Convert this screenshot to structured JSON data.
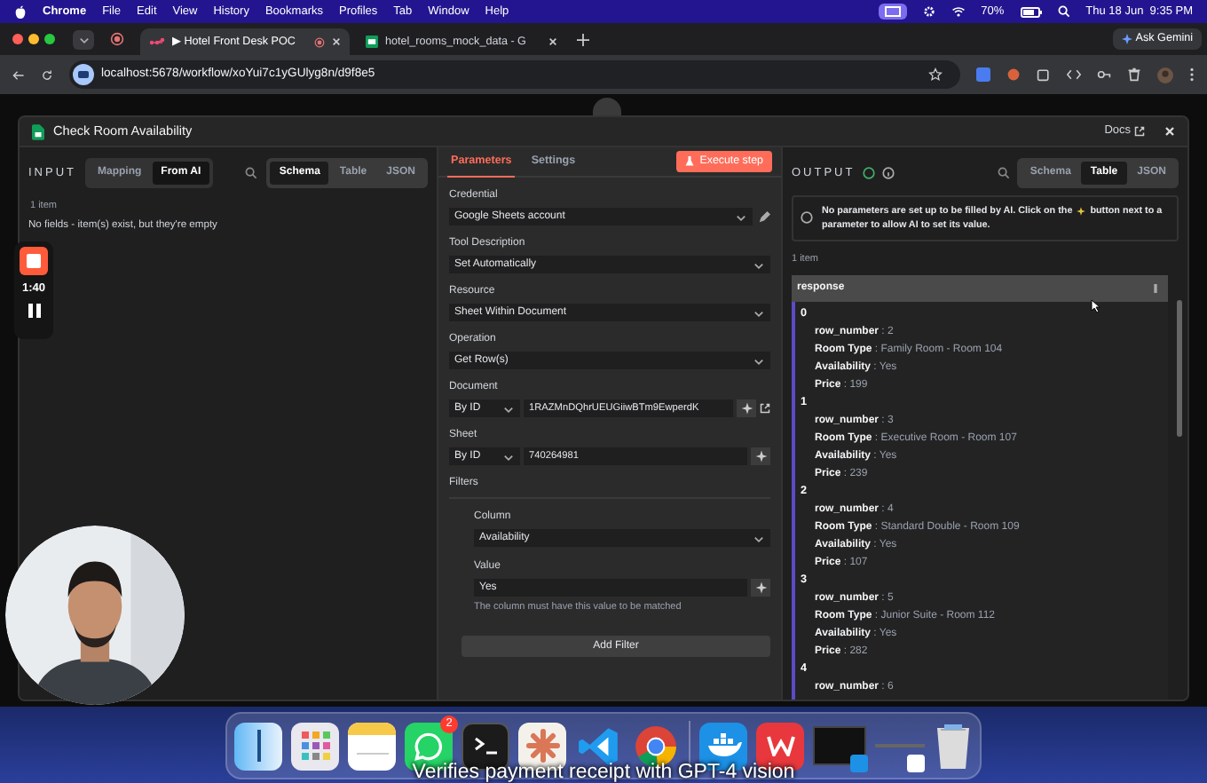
{
  "menu_bar": {
    "app": "Chrome",
    "items": [
      "File",
      "Edit",
      "View",
      "History",
      "Bookmarks",
      "Profiles",
      "Tab",
      "Window",
      "Help"
    ],
    "battery": "70%",
    "clock": "Thu 18 Jun  9:35 PM"
  },
  "browser": {
    "tabs": [
      {
        "title": "▶ Hotel Front Desk POC",
        "selected": true,
        "kind": "n8n"
      },
      {
        "title": "hotel_rooms_mock_data - G",
        "selected": false,
        "kind": "sheets"
      }
    ],
    "gemini": "Ask Gemini",
    "url": "localhost:5678/workflow/xoYui7c1yGUlyg8n/d9f8e5"
  },
  "modal": {
    "title": "Check Room Availability",
    "docs": "Docs",
    "input": {
      "label": "INPUT",
      "modes": [
        {
          "label": "Mapping",
          "selected": false
        },
        {
          "label": "From AI",
          "selected": true
        }
      ],
      "views": [
        {
          "label": "Schema",
          "selected": true
        },
        {
          "label": "Table",
          "selected": false
        },
        {
          "label": "JSON",
          "selected": false
        }
      ],
      "count": "1 item",
      "message": "No fields - item(s) exist, but they're empty"
    },
    "parameters": {
      "tabs": [
        {
          "label": "Parameters",
          "selected": true
        },
        {
          "label": "Settings",
          "selected": false
        }
      ],
      "execute": "Execute step",
      "fields": [
        {
          "kind": "select",
          "label": "Credential",
          "value": "Google Sheets account",
          "editable": true
        },
        {
          "kind": "select",
          "label": "Tool Description",
          "value": "Set Automatically",
          "editable": false
        },
        {
          "kind": "select",
          "label": "Resource",
          "value": "Sheet Within Document",
          "editable": false
        },
        {
          "kind": "select",
          "label": "Operation",
          "value": "Get Row(s)",
          "editable": false
        },
        {
          "kind": "by_id",
          "label": "Document",
          "mode": "By ID",
          "value": "1RAZMnDQhrUEUGiiwBTm9EwperdK",
          "open_link": true
        },
        {
          "kind": "by_id",
          "label": "Sheet",
          "mode": "By ID",
          "value": "740264981",
          "open_link": false
        }
      ],
      "filters": {
        "label": "Filters",
        "column": {
          "label": "Column",
          "value": "Availability"
        },
        "value": {
          "label": "Value",
          "value": "Yes",
          "hint": "The column must have this value to be matched"
        },
        "add": "Add Filter"
      }
    },
    "output": {
      "label": "OUTPUT",
      "views": [
        {
          "label": "Schema",
          "selected": false
        },
        {
          "label": "Table",
          "selected": true
        },
        {
          "label": "JSON",
          "selected": false
        }
      ],
      "notice": [
        "No parameters are set up to be filled by AI. Click on the",
        "button next to a",
        "parameter to allow AI to set its value."
      ],
      "count": "1 item",
      "header": "response",
      "items": [
        {
          "index": "0",
          "lines": [
            "**row_number** : 2",
            "**Room Type** : Family Room - Room 104",
            "**Availability** : Yes",
            "**Price** : 199"
          ]
        },
        {
          "index": "1",
          "lines": [
            "**row_number** : 3",
            "**Room Type** : Executive Room - Room 107",
            "**Availability** : Yes",
            "**Price** : 239"
          ]
        },
        {
          "index": "2",
          "lines": [
            "**row_number** : 4",
            "**Room Type** : Standard Double - Room 109",
            "**Availability** : Yes",
            "**Price** : 107"
          ]
        },
        {
          "index": "3",
          "lines": [
            "**row_number** : 5",
            "**Room Type** : Junior Suite - Room 112",
            "**Availability** : Yes",
            "**Price** : 282"
          ]
        },
        {
          "index": "4",
          "lines": [
            "**row_number** : 6"
          ]
        }
      ]
    }
  },
  "recorder": {
    "time": "1:40"
  },
  "dock": [
    {
      "kind": "finder"
    },
    {
      "kind": "launchpad"
    },
    {
      "kind": "notes"
    },
    {
      "kind": "whatsapp",
      "badge": "2"
    },
    {
      "kind": "terminal"
    },
    {
      "kind": "claude"
    },
    {
      "kind": "vscode"
    },
    {
      "kind": "chrome"
    },
    {
      "kind": "divider"
    },
    {
      "kind": "docker"
    },
    {
      "kind": "wps"
    },
    {
      "kind": "window"
    },
    {
      "kind": "minimized"
    },
    {
      "kind": "trash"
    }
  ],
  "caption": "Verifies payment receipt with GPT-4 vision"
}
